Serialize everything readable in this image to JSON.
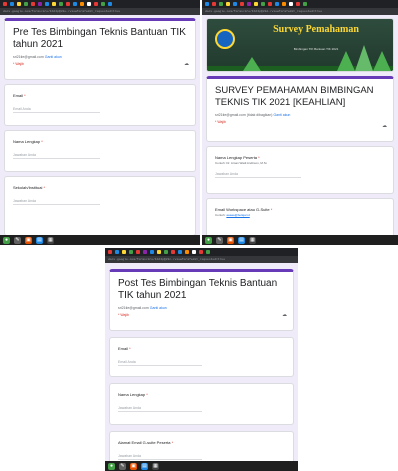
{
  "url_left": "docs.google.com/forms/d/e/1FAIpQLSe…/viewform?edit_requested=true",
  "url_right": "docs.google.com/forms/d/e/1FAIpQLSd…/viewform?edit_requested=true",
  "url_bottom": "docs.google.com/forms/d/e/1FAIpQLSc…/viewform?edit_requested=true",
  "colors": {
    "accent": "#673ab7",
    "bg": "#f0ebf8",
    "required": "#d93025",
    "link": "#1a73e8"
  },
  "icons": {
    "eye": "👁",
    "cloud": "☁",
    "chrome": "●",
    "explorer": "📁",
    "store": "🛍"
  },
  "left_form": {
    "title": "Pre Tes Bimbingan Teknis Bantuan TIK tahun 2021",
    "email": "sri21tie@gmail.com",
    "switch_account": "Ganti akun",
    "required": "* Wajib",
    "q1_label": "Email",
    "q1_placeholder": "Email Anda",
    "q2_label": "Nama Lengkap",
    "q2_placeholder": "Jawaban Anda",
    "q3_label": "Sekolah/Instituai",
    "q3_placeholder": "Jawaban Anda"
  },
  "right_form": {
    "banner_title": "Survey Pemahaman",
    "banner_sub": "Bimbingan TIK Bantuan TIK 2021",
    "title": "SURVEY PEMAHAMAN BIMBINGAN TEKNIS TIK 2021 [KEAHLIAN]",
    "email": "sri21tie@gmail.com",
    "email_note": "(tidak dibagikan)",
    "switch_account": "Ganti akun",
    "required": "* Wajib",
    "q1_label": "Nama Lengkap Peserta",
    "q1_hint": "Contoh: Dr. Aman Wadi Andinum, M.Si.",
    "q1_placeholder": "Jawaban Anda",
    "q2_label": "Email Workspace atau G-Suite",
    "q2_hint_prefix": "Contoh:",
    "q2_hint_link": "aaaaa@belajar.id"
  },
  "bottom_form": {
    "title": "Post Tes Bimbingan Teknis Bantuan TIK tahun 2021",
    "email": "sri21tie@gmail.com",
    "switch_account": "Ganti akun",
    "required": "* Wajib",
    "q1_label": "Email",
    "q1_placeholder": "Email Anda",
    "q2_label": "Nama Lengkap",
    "q2_placeholder": "Jawaban Anda",
    "q3_label": "Alamat Email G-suite Peserta",
    "q3_placeholder": "Jawaban Anda"
  }
}
